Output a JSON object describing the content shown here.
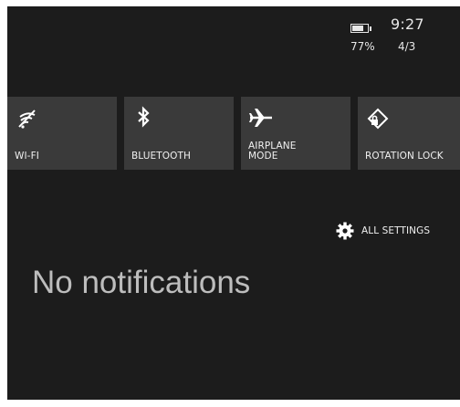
{
  "status_bar": {
    "time": "9:27",
    "battery_percent": "77%",
    "battery_level": 0.77,
    "date": "4/3",
    "icon": "battery-icon"
  },
  "quick_actions": [
    {
      "id": "wifi",
      "label": "WI-FI",
      "icon": "wifi-icon"
    },
    {
      "id": "bluetooth",
      "label": "BLUETOOTH",
      "icon": "bluetooth-icon"
    },
    {
      "id": "airplane",
      "label": "AIRPLANE\nMODE",
      "icon": "airplane-icon"
    },
    {
      "id": "rotation",
      "label": "ROTATION LOCK",
      "icon": "rotation-lock-icon"
    }
  ],
  "settings_link": {
    "label": "ALL SETTINGS",
    "icon": "gear-icon"
  },
  "notifications": {
    "empty_message": "No notifications"
  },
  "colors": {
    "background": "#1c1c1c",
    "tile": "#3a3a3a",
    "text": "#ffffff",
    "muted_text": "#bdbdbd"
  }
}
